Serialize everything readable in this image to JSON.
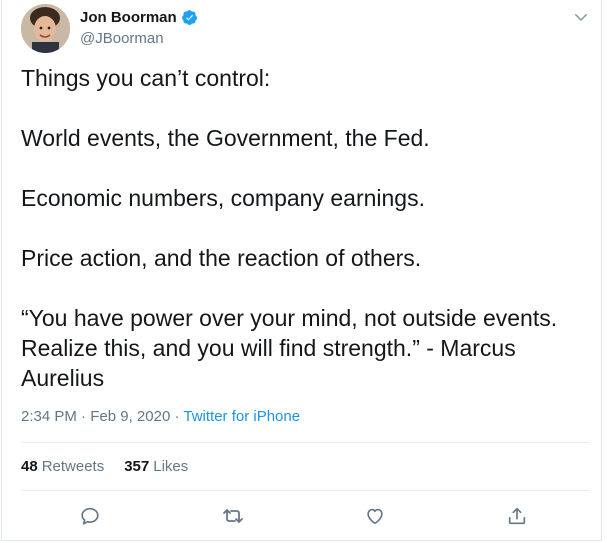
{
  "author": {
    "name": "Jon Boorman",
    "handle": "@JBoorman"
  },
  "tweet": {
    "text": "Things you can’t control:\n\nWorld events, the Government, the Fed.\n\nEconomic numbers, company earnings.\n\nPrice action, and the reaction of others.\n\n“You have power over your mind, not outside events.\nRealize this, and you will find strength.” - Marcus\nAurelius",
    "time": "2:34 PM",
    "date": "Feb 9, 2020",
    "source": "Twitter for iPhone"
  },
  "stats": {
    "retweets_count": "48",
    "retweets_label": "Retweets",
    "likes_count": "357",
    "likes_label": "Likes"
  },
  "colors": {
    "verified": "#1da1f2",
    "link": "#1b95e0",
    "muted": "#657786"
  },
  "icons": [
    "verified-badge-icon",
    "chevron-down-icon",
    "reply-icon",
    "retweet-icon",
    "like-icon",
    "share-icon"
  ]
}
